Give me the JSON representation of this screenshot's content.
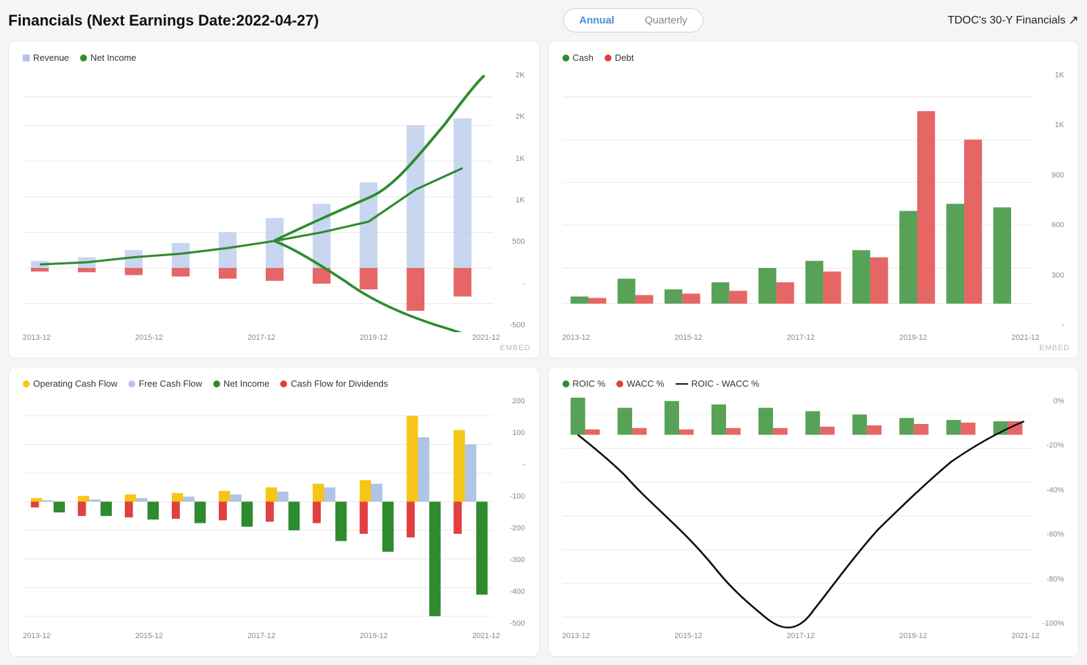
{
  "header": {
    "title": "Financials (Next Earnings Date:2022-04-27)",
    "toggle_annual": "Annual",
    "toggle_quarterly": "Quarterly",
    "link_label": "TDOC's 30-Y Financials",
    "link_arrow": "↗"
  },
  "charts": [
    {
      "id": "revenue-income",
      "legend": [
        {
          "label": "Revenue",
          "color": "#b0c4e8",
          "type": "square"
        },
        {
          "label": "Net Income",
          "color": "#2e8b2e",
          "type": "dot"
        }
      ],
      "y_labels": [
        "2K",
        "2K",
        "1K",
        "1K",
        "500",
        "-",
        "-500"
      ],
      "x_labels": [
        "2013-12",
        "2015-12",
        "2017-12",
        "2019-12",
        "2021-12"
      ]
    },
    {
      "id": "cash-debt",
      "legend": [
        {
          "label": "Cash",
          "color": "#2e8b2e",
          "type": "dot"
        },
        {
          "label": "Debt",
          "color": "#e04040",
          "type": "dot"
        }
      ],
      "y_labels": [
        "1K",
        "1K",
        "900",
        "600",
        "300",
        "-"
      ],
      "x_labels": [
        "2013-12",
        "2015-12",
        "2017-12",
        "2019-12",
        "2021-12"
      ]
    },
    {
      "id": "cashflow",
      "legend": [
        {
          "label": "Operating Cash Flow",
          "color": "#f5c518",
          "type": "dot"
        },
        {
          "label": "Free Cash Flow",
          "color": "#b0c4e8",
          "type": "dot"
        },
        {
          "label": "Net Income",
          "color": "#2e8b2e",
          "type": "dot"
        },
        {
          "label": "Cash Flow for Dividends",
          "color": "#e04040",
          "type": "dot"
        }
      ],
      "y_labels": [
        "200",
        "100",
        "-",
        "-100",
        "-200",
        "-300",
        "-400",
        "-500"
      ],
      "x_labels": [
        "2013-12",
        "2015-12",
        "2017-12",
        "2019-12",
        "2021-12"
      ]
    },
    {
      "id": "roic",
      "legend": [
        {
          "label": "ROIC %",
          "color": "#2e8b2e",
          "type": "dot"
        },
        {
          "label": "WACC %",
          "color": "#e04040",
          "type": "dot"
        },
        {
          "label": "ROIC - WACC %",
          "color": "#111",
          "type": "line"
        }
      ],
      "y_labels": [
        "0%",
        "-20%",
        "-40%",
        "-60%",
        "-80%",
        "-100%"
      ],
      "x_labels": [
        "2013-12",
        "2015-12",
        "2017-12",
        "2019-12",
        "2021-12"
      ]
    }
  ],
  "colors": {
    "blue_bar": "#b0c4e8",
    "green": "#2e8b2e",
    "red": "#e04040",
    "yellow": "#f5c518",
    "black": "#111111",
    "grid_line": "#e8e8e8",
    "text_muted": "#888888"
  }
}
